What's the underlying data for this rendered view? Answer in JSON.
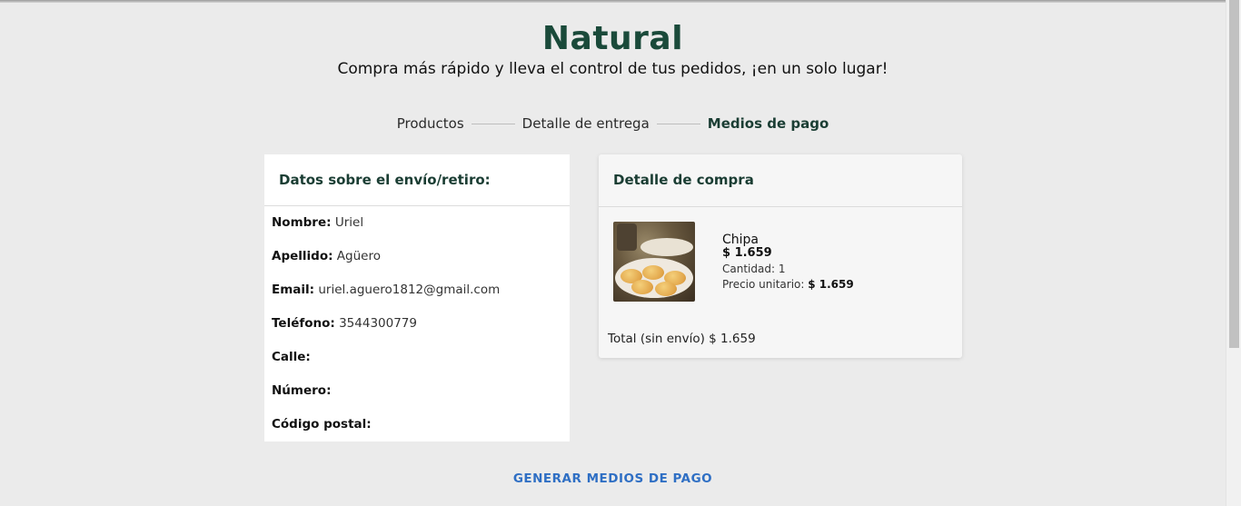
{
  "header": {
    "brand": "Natural",
    "tagline": "Compra más rápido y lleva el control de tus pedidos, ¡en un solo lugar!"
  },
  "steps": [
    {
      "label": "Productos"
    },
    {
      "label": "Detalle de entrega"
    },
    {
      "label": "Medios de pago",
      "active": true
    }
  ],
  "shipping": {
    "title": "Datos sobre el envío/retiro:",
    "fields": [
      {
        "label": "Nombre:",
        "value": "Uriel"
      },
      {
        "label": "Apellido:",
        "value": "Agüero"
      },
      {
        "label": "Email:",
        "value": "uriel.aguero1812@gmail.com"
      },
      {
        "label": "Teléfono:",
        "value": "3544300779"
      },
      {
        "label": "Calle:",
        "value": ""
      },
      {
        "label": "Número:",
        "value": ""
      },
      {
        "label": "Código postal:",
        "value": ""
      }
    ]
  },
  "order": {
    "title": "Detalle de compra",
    "item": {
      "name": "Chipa",
      "price": "$ 1.659",
      "quantity_label": "Cantidad: 1",
      "unit_price_label": "Precio unitario:",
      "unit_price": "$ 1.659"
    },
    "total_label": "Total (sin envío) $ 1.659"
  },
  "actions": {
    "generate": "GENERAR MEDIOS DE PAGO"
  },
  "colors": {
    "brand": "#1a4a3a",
    "link": "#2f6fc4",
    "background": "#ebebeb"
  }
}
